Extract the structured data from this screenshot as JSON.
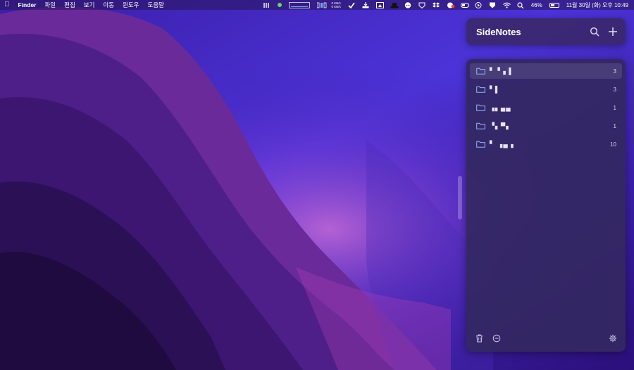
{
  "menubar": {
    "app_name": "Finder",
    "menus": [
      "파일",
      "편집",
      "보기",
      "이동",
      "윈도우",
      "도움말"
    ],
    "net_up": "0 KB/s",
    "net_down": "0 KB/s",
    "battery_percent": "46%",
    "datetime": "11월 30일 (화) 오후 10:49"
  },
  "sidenotes": {
    "title": "SideNotes",
    "folders": [
      {
        "name": "▘▝ ▖▌",
        "count": "3",
        "selected": true
      },
      {
        "name": "▘▌",
        "count": "3",
        "selected": false
      },
      {
        "name": "▗▖▄▄",
        "count": "1",
        "selected": false
      },
      {
        "name": "▝▖▀▖",
        "count": "1",
        "selected": false
      },
      {
        "name": "▘ ▗▄ ▖",
        "count": "10",
        "selected": false
      }
    ]
  },
  "colors": {
    "panel_bg": "#34285f",
    "header_bg": "#3a286e",
    "folder_icon": "#8fb4ff",
    "text": "#ffffff"
  }
}
